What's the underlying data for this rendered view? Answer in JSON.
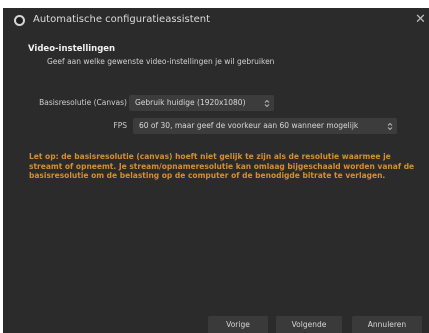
{
  "window": {
    "title": "Automatische configuratieassistent",
    "close_glyph": "✕"
  },
  "section": {
    "title": "Video-instellingen",
    "subtitle": "Geef aan welke gewenste video-instellingen je wil gebruiken"
  },
  "base_resolution": {
    "label": "Basisresolutie (Canvas)",
    "value": "Gebruik huidige (1920x1080)",
    "chevron": "⌃⌄"
  },
  "fps": {
    "label": "FPS",
    "value": "60 of 30, maar geef de voorkeur aan 60 wanneer mogelijk",
    "chevron": "⌃⌄"
  },
  "warning_text": "Let op: de basisresolutie (canvas) hoeft niet gelijk te zijn als de resolutie waarmee je streamt of opneemt. Je stream/opnameresolutie kan omlaag bijgeschaald worden vanaf de basisresolutie om de belasting op de computer of de benodigde bitrate te verlagen.",
  "buttons": {
    "back": "Vorige",
    "next": "Volgende",
    "cancel": "Annuleren"
  },
  "colors": {
    "background": "#2b2b2b",
    "warning": "#d68f2e",
    "control": "#3c3c3c"
  },
  "icons": {
    "app": "obs-logo-icon",
    "close": "close-icon",
    "dropdown": "updown-chevron-icon"
  }
}
